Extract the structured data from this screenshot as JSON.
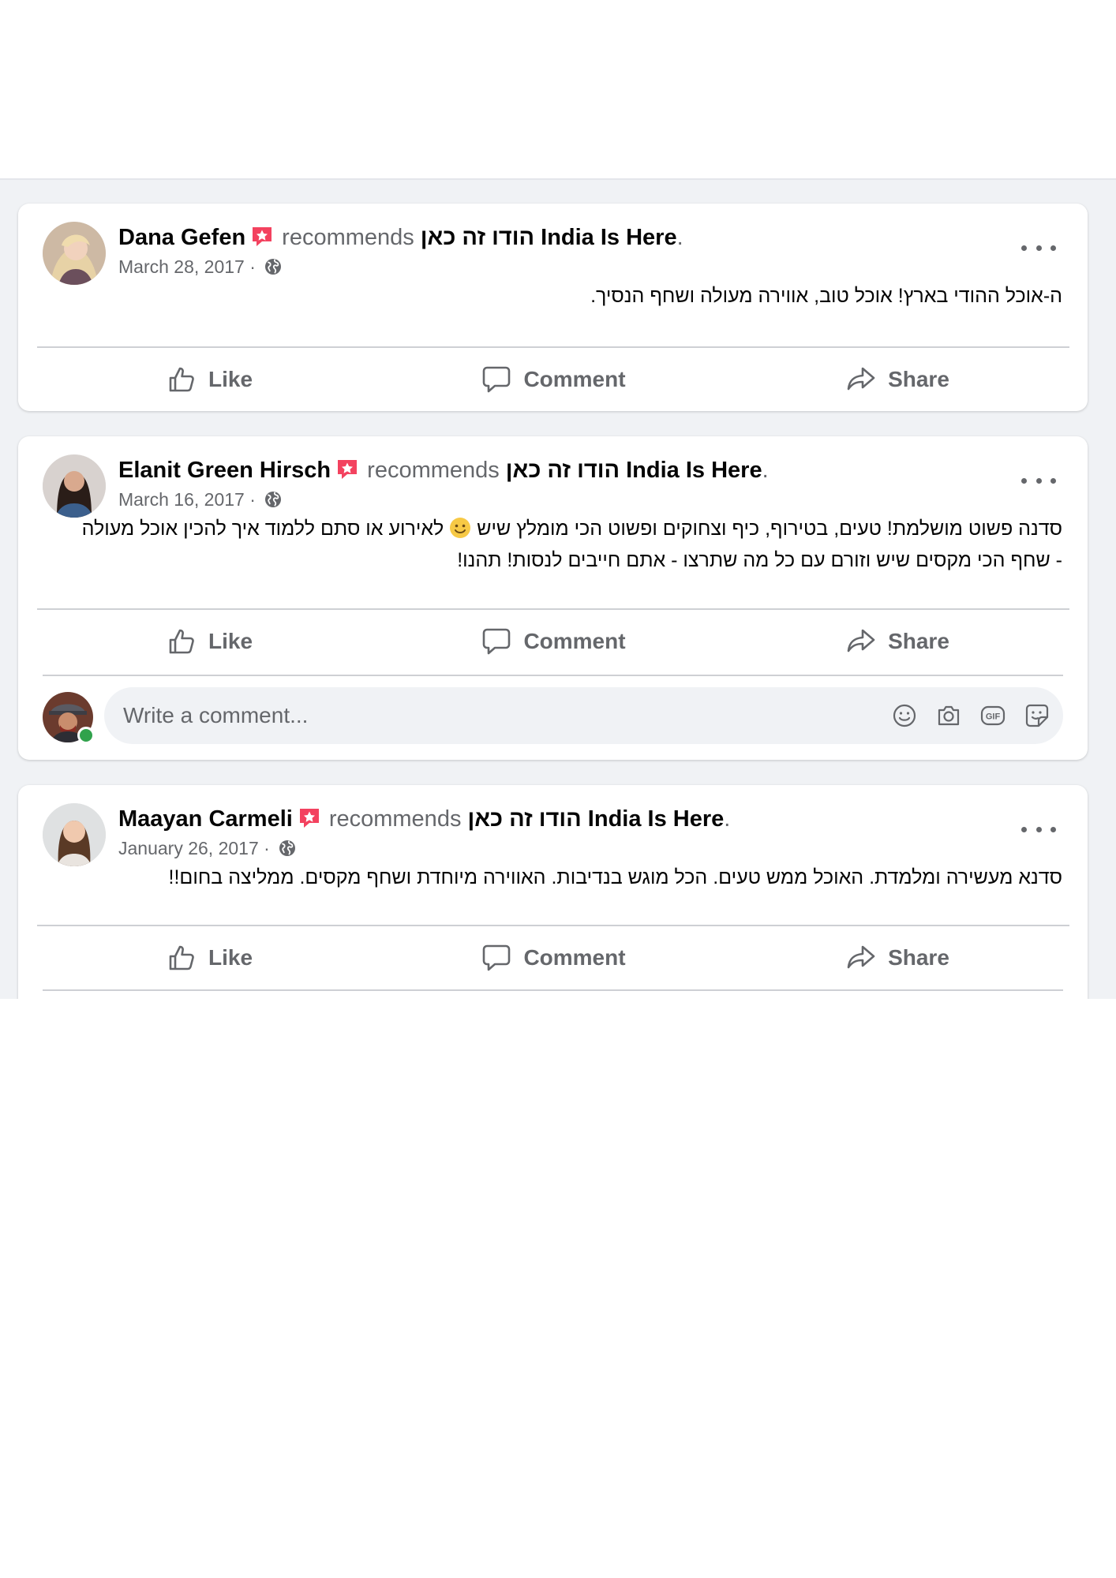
{
  "actions": {
    "like": "Like",
    "comment": "Comment",
    "share": "Share"
  },
  "posts": [
    {
      "author": "Dana Gefen",
      "verb": "recommends",
      "page": "הודו זה כאן India Is Here",
      "period": ".",
      "date": "March 28, 2017 ·",
      "text": "ה-אוכל ההודי בארץ! אוכל טוב, אווירה מעולה ושחף הנסיך."
    },
    {
      "author": "Elanit Green Hirsch",
      "verb": "recommends",
      "page": "הודו זה כאן India Is Here",
      "period": ".",
      "date": "March 16, 2017 ·",
      "text_before_emoji": "סדנה פשוט מושלמת! טעים, בטירוף, כיף וצחוקים ופשוט הכי מומלץ שיש",
      "text_after_emoji": "לאירוע או סתם ללמוד איך להכין אוכל מעולה - שחף הכי מקסים שיש וזורם עם כל מה שתרצו - אתם חייבים לנסות! תהנו!",
      "comment_placeholder": "Write a comment..."
    },
    {
      "author": "Maayan Carmeli",
      "verb": "recommends",
      "page": "הודו זה כאן India Is Here",
      "period": ".",
      "date": "January 26, 2017 ·",
      "text": "סדנא מעשירה ומלמדת. האוכל ממש טעים. הכל מוגש בנדיבות. האווירה מיוחדת ושחף מקסים. ממליצה בחום!!"
    }
  ],
  "icons": {
    "more": "more-options-icon",
    "recommend_badge": "recommendation-star-icon",
    "privacy": "globe-icon",
    "like": "thumbs-up-icon",
    "comment": "speech-bubble-icon",
    "share": "share-arrow-icon",
    "emoji": "smiley-icon",
    "camera": "camera-icon",
    "gif": "gif-icon",
    "sticker": "sticker-icon"
  },
  "colors": {
    "feed_bg": "#f0f2f5",
    "secondary_text": "#65676b",
    "recommend_badge": "#f3425f",
    "online": "#31a24c"
  }
}
